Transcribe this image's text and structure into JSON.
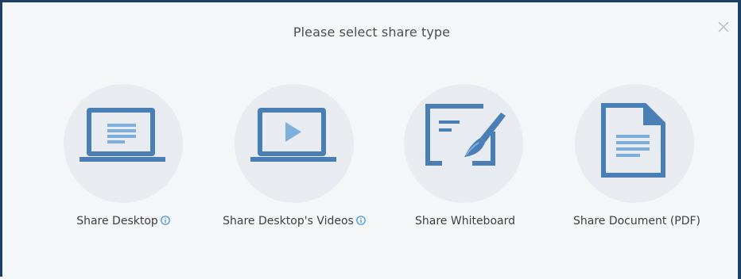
{
  "dialog": {
    "title": "Please select share type",
    "close_icon": "close-icon"
  },
  "options": [
    {
      "label": "Share Desktop",
      "icon": "laptop-screen-icon",
      "has_info": true
    },
    {
      "label": "Share Desktop's Videos",
      "icon": "laptop-video-icon",
      "has_info": true
    },
    {
      "label": "Share Whiteboard",
      "icon": "whiteboard-brush-icon",
      "has_info": false
    },
    {
      "label": "Share Document (PDF)",
      "icon": "document-icon",
      "has_info": false
    }
  ],
  "colors": {
    "icon_blue": "#4a7fb5",
    "icon_light_blue": "#7fb0dd",
    "circle_bg": "#e8ebef",
    "info_blue": "#3a8fd8",
    "frame": "#1e3f66"
  }
}
